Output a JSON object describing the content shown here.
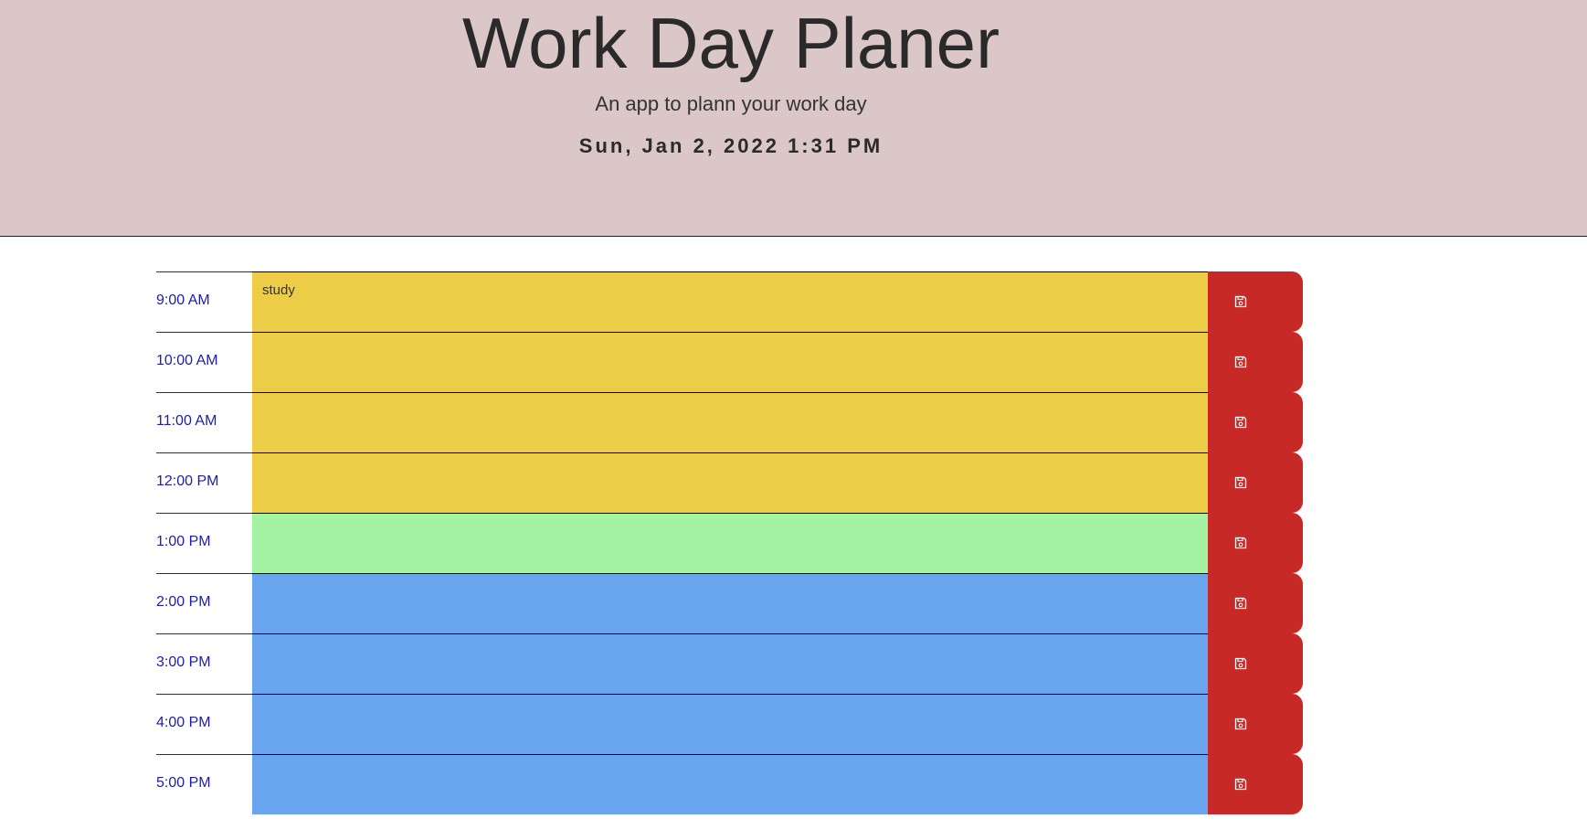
{
  "header": {
    "title": "Work Day Planer",
    "subtitle": "An app to plann your work day",
    "current_day": "Sun, Jan 2, 2022 1:31 PM"
  },
  "colors": {
    "past": "#edcd48",
    "present": "#a3f3a2",
    "future": "#69a4ef",
    "save": "#c72926"
  },
  "time_blocks": [
    {
      "hour": "9:00 AM",
      "text": "study",
      "state": "past",
      "save_icon": "floppy-disk-icon"
    },
    {
      "hour": "10:00 AM",
      "text": "",
      "state": "past",
      "save_icon": "floppy-disk-icon"
    },
    {
      "hour": "11:00 AM",
      "text": "",
      "state": "past",
      "save_icon": "floppy-disk-icon"
    },
    {
      "hour": "12:00 PM",
      "text": "",
      "state": "past",
      "save_icon": "floppy-disk-icon"
    },
    {
      "hour": "1:00 PM",
      "text": "",
      "state": "present",
      "save_icon": "floppy-disk-icon"
    },
    {
      "hour": "2:00 PM",
      "text": "",
      "state": "future",
      "save_icon": "floppy-disk-icon"
    },
    {
      "hour": "3:00 PM",
      "text": "",
      "state": "future",
      "save_icon": "floppy-disk-icon"
    },
    {
      "hour": "4:00 PM",
      "text": "",
      "state": "future",
      "save_icon": "floppy-disk-icon"
    },
    {
      "hour": "5:00 PM",
      "text": "",
      "state": "future",
      "save_icon": "floppy-disk-icon"
    }
  ]
}
